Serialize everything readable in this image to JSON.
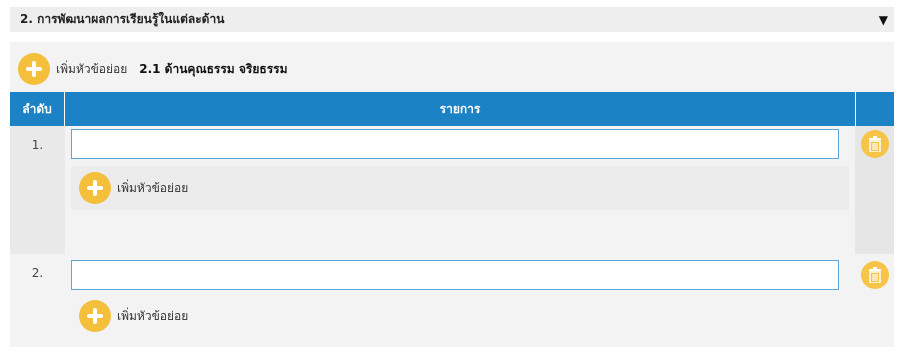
{
  "section": {
    "title": "2. การพัฒนาผลการเรียนรู้ในแต่ละด้าน",
    "toggle_glyph": "▼"
  },
  "subheader": {
    "add_label": "เพิ่มหัวข้อย่อย",
    "title": "2.1 ด้านคุณธรรม จริยธรรม"
  },
  "table": {
    "columns": [
      "ลำดับ",
      "รายการ",
      ""
    ],
    "rows": [
      {
        "order": "1.",
        "value": "",
        "add_label": "เพิ่มหัวข้อย่อย"
      },
      {
        "order": "2.",
        "value": "",
        "add_label": "เพิ่มหัวข้อย่อย"
      }
    ]
  },
  "icons": {
    "collapse": "caret-down-icon",
    "add": "plus-circle-icon",
    "delete": "trash-icon"
  },
  "colors": {
    "header_blue": "#1b82c5",
    "accent_yellow": "#f4bf3a",
    "input_border": "#5aa7d8"
  }
}
